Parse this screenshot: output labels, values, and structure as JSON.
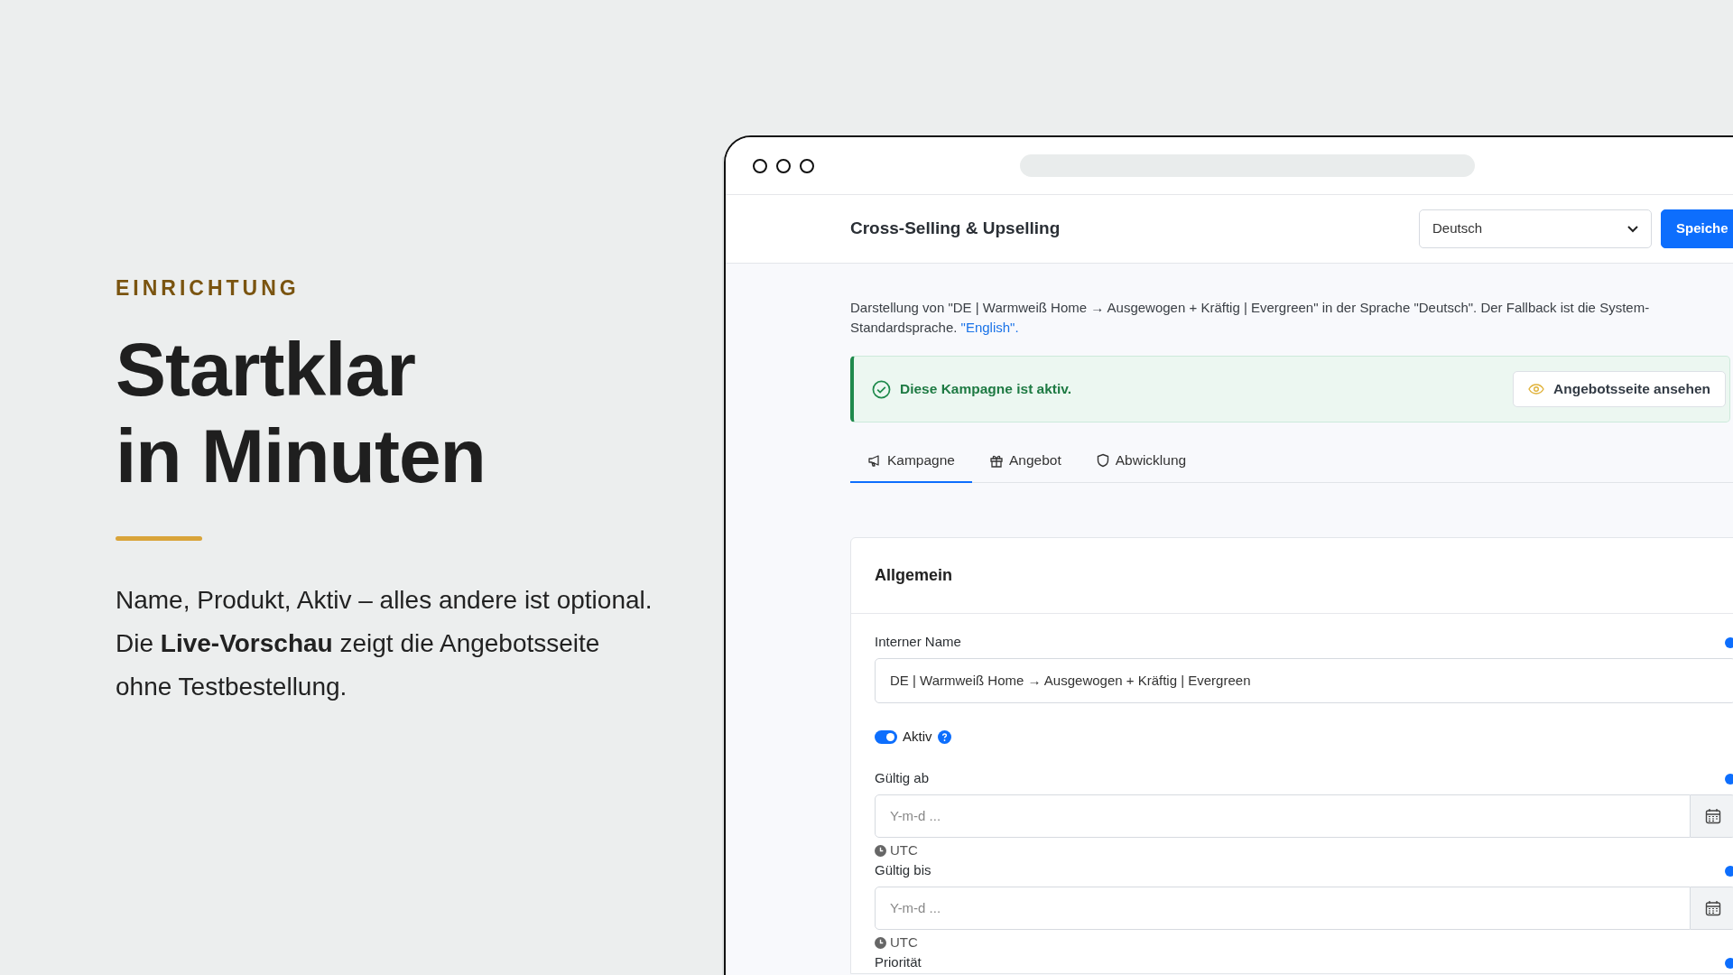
{
  "intro": {
    "eyebrow": "EINRICHTUNG",
    "heading": "Startklar\nin Minuten",
    "text": "Name, Produkt, Aktiv – alles andere ist optional. Die **Live-Vorschau** zeigt die Angebotsseite ohne Testbestellung."
  },
  "app": {
    "title": "Cross-Selling & Upselling",
    "language": "Deutsch",
    "save": "Speiche",
    "description": "Darstellung von \"DE | Warmweiß Home → Ausgewogen + Kräftig | Evergreen\" in der Sprache \"Deutsch\". Der Fallback ist die System-Standardsprache.",
    "description_link": "\"English\".",
    "alert": {
      "text": "Diese Kampagne ist aktiv.",
      "button": "Angebotsseite ansehen"
    },
    "tabs": [
      {
        "label": "Kampagne",
        "selected": true
      },
      {
        "label": "Angebot",
        "selected": false
      },
      {
        "label": "Abwicklung",
        "selected": false
      }
    ],
    "card": {
      "title": "Allgemein",
      "fields": [
        {
          "kind": "text",
          "label": "Interner Name",
          "value": "DE | Warmweiß Home → Ausgewogen + Kräftig | Evergreen"
        },
        {
          "kind": "switch",
          "label": "Aktiv",
          "on": true
        },
        {
          "kind": "date",
          "label": "Gültig ab",
          "placeholder": "Y-m-d ...",
          "note": "UTC"
        },
        {
          "kind": "date",
          "label": "Gültig bis",
          "placeholder": "Y-m-d ...",
          "note": "UTC"
        },
        {
          "kind": "label",
          "label": "Priorität"
        }
      ]
    }
  }
}
